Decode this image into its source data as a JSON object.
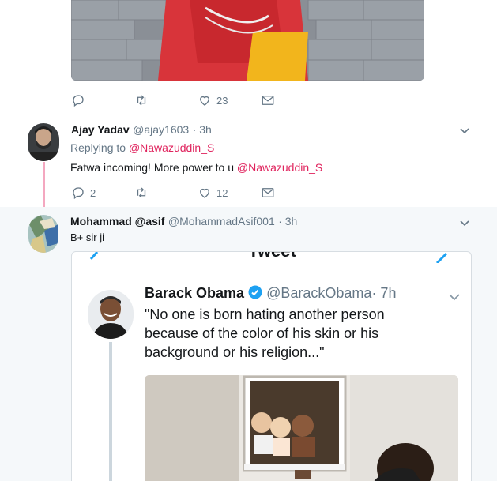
{
  "top_tweet": {
    "actions": {
      "reply_count": "",
      "retweet_count": "",
      "like_count": "23"
    }
  },
  "reply1": {
    "name": "Ajay Yadav",
    "handle": "@ajay1603",
    "time": "· 3h",
    "replying_prefix": "Replying to",
    "replying_to": "@Nawazuddin_S",
    "text_prefix": "Fatwa incoming! More power to u",
    "text_mention": "@Nawazuddin_S",
    "actions": {
      "reply_count": "2",
      "retweet_count": "",
      "like_count": "12"
    }
  },
  "reply2": {
    "name": "Mohammad @asif",
    "handle": "@MohammadAsif001",
    "time": "· 3h",
    "text": "B+ sir ji",
    "embedded_screenshot": {
      "header_title": "Tweet",
      "name": "Barack Obama",
      "handle": "@BarackObama",
      "time": "· 7h",
      "text": "\"No one is born hating another person because of the color of his skin or his background or his religion...\""
    }
  },
  "colors": {
    "accent_blue": "#1da1f2",
    "mention_pink": "#e0245e",
    "muted_gray": "#657786",
    "verified_blue": "#1da1f2"
  }
}
